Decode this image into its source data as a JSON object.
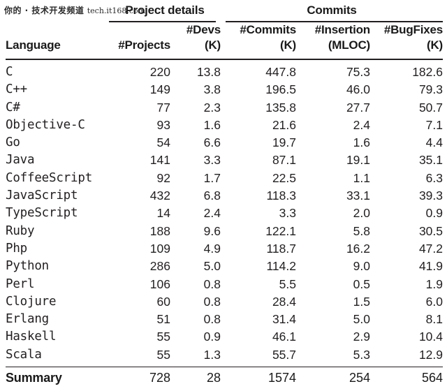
{
  "watermark": {
    "cn_text": "你的 · 技术开发频道",
    "en_text": "tech.it168.com"
  },
  "table": {
    "group_headers": [
      {
        "label": "Project details"
      },
      {
        "label": "Commits"
      }
    ],
    "columns": [
      {
        "line1": "Language",
        "line2": ""
      },
      {
        "line1": "#Projects",
        "line2": ""
      },
      {
        "line1": "#Devs",
        "line2": "(K)"
      },
      {
        "line1": "#Commits",
        "line2": "(K)"
      },
      {
        "line1": "#Insertion",
        "line2": "(MLOC)"
      },
      {
        "line1": "#BugFixes",
        "line2": "(K)"
      }
    ],
    "rows": [
      {
        "language": "C",
        "projects": "220",
        "devs": "13.8",
        "commits": "447.8",
        "insertion": "75.3",
        "bugfixes": "182.6"
      },
      {
        "language": "C++",
        "projects": "149",
        "devs": "3.8",
        "commits": "196.5",
        "insertion": "46.0",
        "bugfixes": "79.3"
      },
      {
        "language": "C#",
        "projects": "77",
        "devs": "2.3",
        "commits": "135.8",
        "insertion": "27.7",
        "bugfixes": "50.7"
      },
      {
        "language": "Objective-C",
        "projects": "93",
        "devs": "1.6",
        "commits": "21.6",
        "insertion": "2.4",
        "bugfixes": "7.1"
      },
      {
        "language": "Go",
        "projects": "54",
        "devs": "6.6",
        "commits": "19.7",
        "insertion": "1.6",
        "bugfixes": "4.4"
      },
      {
        "language": "Java",
        "projects": "141",
        "devs": "3.3",
        "commits": "87.1",
        "insertion": "19.1",
        "bugfixes": "35.1"
      },
      {
        "language": "CoffeeScript",
        "projects": "92",
        "devs": "1.7",
        "commits": "22.5",
        "insertion": "1.1",
        "bugfixes": "6.3"
      },
      {
        "language": "JavaScript",
        "projects": "432",
        "devs": "6.8",
        "commits": "118.3",
        "insertion": "33.1",
        "bugfixes": "39.3"
      },
      {
        "language": "TypeScript",
        "projects": "14",
        "devs": "2.4",
        "commits": "3.3",
        "insertion": "2.0",
        "bugfixes": "0.9"
      },
      {
        "language": "Ruby",
        "projects": "188",
        "devs": "9.6",
        "commits": "122.1",
        "insertion": "5.8",
        "bugfixes": "30.5"
      },
      {
        "language": "Php",
        "projects": "109",
        "devs": "4.9",
        "commits": "118.7",
        "insertion": "16.2",
        "bugfixes": "47.2"
      },
      {
        "language": "Python",
        "projects": "286",
        "devs": "5.0",
        "commits": "114.2",
        "insertion": "9.0",
        "bugfixes": "41.9"
      },
      {
        "language": "Perl",
        "projects": "106",
        "devs": "0.8",
        "commits": "5.5",
        "insertion": "0.5",
        "bugfixes": "1.9"
      },
      {
        "language": "Clojure",
        "projects": "60",
        "devs": "0.8",
        "commits": "28.4",
        "insertion": "1.5",
        "bugfixes": "6.0"
      },
      {
        "language": "Erlang",
        "projects": "51",
        "devs": "0.8",
        "commits": "31.4",
        "insertion": "5.0",
        "bugfixes": "8.1"
      },
      {
        "language": "Haskell",
        "projects": "55",
        "devs": "0.9",
        "commits": "46.1",
        "insertion": "2.9",
        "bugfixes": "10.4"
      },
      {
        "language": "Scala",
        "projects": "55",
        "devs": "1.3",
        "commits": "55.7",
        "insertion": "5.3",
        "bugfixes": "12.9"
      }
    ],
    "summary": {
      "label": "Summary",
      "projects": "728",
      "devs": "28",
      "commits": "1574",
      "insertion": "254",
      "bugfixes": "564"
    }
  },
  "chart_data": {
    "type": "table",
    "title": "",
    "group_headers": [
      "Project details",
      "Commits"
    ],
    "columns": [
      "Language",
      "#Projects",
      "#Devs (K)",
      "#Commits (K)",
      "#Insertion (MLOC)",
      "#BugFixes (K)"
    ],
    "categories": [
      "C",
      "C++",
      "C#",
      "Objective-C",
      "Go",
      "Java",
      "CoffeeScript",
      "JavaScript",
      "TypeScript",
      "Ruby",
      "Php",
      "Python",
      "Perl",
      "Clojure",
      "Erlang",
      "Haskell",
      "Scala"
    ],
    "series": [
      {
        "name": "#Projects",
        "values": [
          220,
          149,
          77,
          93,
          54,
          141,
          92,
          432,
          14,
          188,
          109,
          286,
          106,
          60,
          51,
          55,
          55
        ],
        "total": 728
      },
      {
        "name": "#Devs (K)",
        "values": [
          13.8,
          3.8,
          2.3,
          1.6,
          6.6,
          3.3,
          1.7,
          6.8,
          2.4,
          9.6,
          4.9,
          5.0,
          0.8,
          0.8,
          0.8,
          0.9,
          1.3
        ],
        "total": 28
      },
      {
        "name": "#Commits (K)",
        "values": [
          447.8,
          196.5,
          135.8,
          21.6,
          19.7,
          87.1,
          22.5,
          118.3,
          3.3,
          122.1,
          118.7,
          114.2,
          5.5,
          28.4,
          31.4,
          46.1,
          55.7
        ],
        "total": 1574
      },
      {
        "name": "#Insertion (MLOC)",
        "values": [
          75.3,
          46.0,
          27.7,
          2.4,
          1.6,
          19.1,
          1.1,
          33.1,
          2.0,
          5.8,
          16.2,
          9.0,
          0.5,
          1.5,
          5.0,
          2.9,
          5.3
        ],
        "total": 254
      },
      {
        "name": "#BugFixes (K)",
        "values": [
          182.6,
          79.3,
          50.7,
          7.1,
          4.4,
          35.1,
          6.3,
          39.3,
          0.9,
          30.5,
          47.2,
          41.9,
          1.9,
          6.0,
          8.1,
          10.4,
          12.9
        ],
        "total": 564
      }
    ],
    "summary_label": "Summary"
  }
}
